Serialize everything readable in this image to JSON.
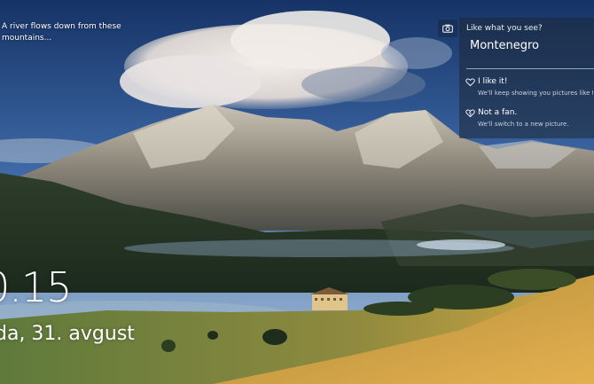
{
  "caption": "A river flows down from these mountains...",
  "panel": {
    "title": "Like what you see?",
    "location": "Montenegro",
    "options": [
      {
        "label": "I like it!",
        "description": "We'll keep showing you pictures like this.",
        "icon": "heart-icon"
      },
      {
        "label": "Not a fan.",
        "description": "We'll switch to a new picture.",
        "icon": "broken-heart-icon"
      }
    ]
  },
  "clock": {
    "time": "0.15",
    "date": "da, 31. avgust"
  },
  "colors": {
    "panel_bg": "#1e2837",
    "accent_text": "#ffffff"
  },
  "icons": {
    "camera": "camera-icon"
  }
}
